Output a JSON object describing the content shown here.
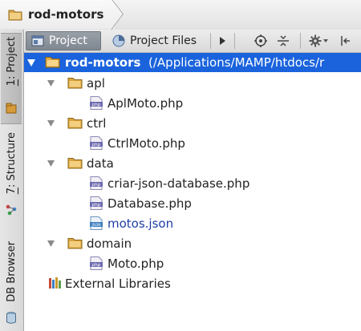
{
  "breadcrumb": {
    "project": "rod-motors"
  },
  "sidebar": {
    "project_num": "1",
    "project_label": ": Project",
    "structure_num": "7",
    "structure_label": ": Structure",
    "db_label": "DB Browser"
  },
  "toolbar": {
    "tab_project": "Project",
    "tab_project_files": "Project Files"
  },
  "tree": {
    "root_name": "rod-motors",
    "root_path": "(/Applications/MAMP/htdocs/r",
    "folders": {
      "apl": "apl",
      "ctrl": "ctrl",
      "data": "data",
      "domain": "domain"
    },
    "files": {
      "aplmoto": "AplMoto.php",
      "ctrlmoto": "CtrlMoto.php",
      "criar": "criar-json-database.php",
      "database": "Database.php",
      "motos": "motos.json",
      "moto": "Moto.php"
    },
    "external": "External Libraries",
    "php_badge": "php",
    "json_badge": "JSON"
  },
  "colors": {
    "selection": "#1a63dd",
    "folder": "#c89a3a",
    "json_text": "#1e3fa8"
  }
}
